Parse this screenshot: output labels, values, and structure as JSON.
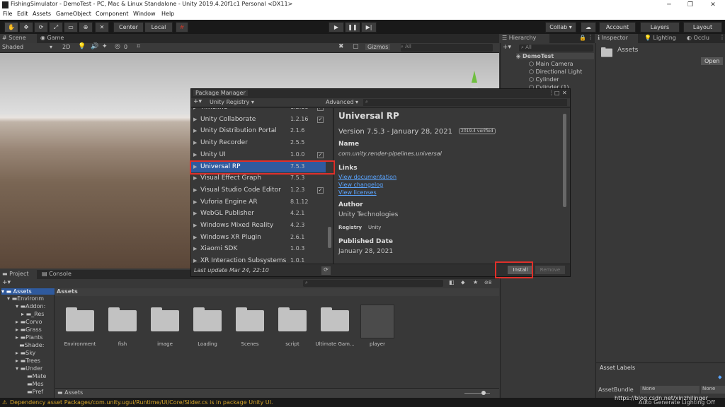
{
  "window": {
    "title": "FishingSimulator - DemoTest - PC, Mac & Linux Standalone - Unity 2019.4.20f1c1 Personal <DX11>",
    "controls": [
      "─",
      "❐",
      "✕"
    ]
  },
  "menu": [
    "File",
    "Edit",
    "Assets",
    "GameObject",
    "Component",
    "Window",
    "Help"
  ],
  "toolbar": {
    "center": "Center",
    "local": "Local",
    "collab": "Collab ▾",
    "account": "Account",
    "layers": "Layers",
    "layout": "Layout"
  },
  "scene": {
    "tabs": [
      "Scene",
      "Game"
    ],
    "shading": "Shaded",
    "mode_2d": "2D",
    "fx_count": "0",
    "gizmos": "Gizmos",
    "search_placeholder": "All"
  },
  "hierarchy": {
    "title": "Hierarchy",
    "search_placeholder": "All",
    "scene_name": "DemoTest",
    "items": [
      "Main Camera",
      "Directional Light",
      "Cylinder",
      "Cylinder (1)"
    ]
  },
  "inspector": {
    "tabs": [
      "Inspector",
      "Lighting",
      "Occlu"
    ],
    "asset_title": "Assets",
    "open_button": "Open",
    "asset_labels": "Asset Labels",
    "asset_bundle_label": "AssetBundle",
    "asset_bundle_value": "None",
    "asset_bundle_variant": "None"
  },
  "package_manager": {
    "title": "Package Manager",
    "registry": "Unity Registry",
    "advanced": "Advanced",
    "packages": [
      {
        "name": "Timeline",
        "version": "1.2.18",
        "checked": true
      },
      {
        "name": "Unity Collaborate",
        "version": "1.2.16",
        "checked": true
      },
      {
        "name": "Unity Distribution Portal",
        "version": "2.1.6",
        "checked": false
      },
      {
        "name": "Unity Recorder",
        "version": "2.5.5",
        "checked": false
      },
      {
        "name": "Unity UI",
        "version": "1.0.0",
        "checked": true
      },
      {
        "name": "Universal RP",
        "version": "7.5.3",
        "checked": false
      },
      {
        "name": "Visual Effect Graph",
        "version": "7.5.3",
        "checked": false
      },
      {
        "name": "Visual Studio Code Editor",
        "version": "1.2.3",
        "checked": true
      },
      {
        "name": "Vuforia Engine AR",
        "version": "8.1.12",
        "checked": false
      },
      {
        "name": "WebGL Publisher",
        "version": "4.2.1",
        "checked": false
      },
      {
        "name": "Windows Mixed Reality",
        "version": "4.2.3",
        "checked": false
      },
      {
        "name": "Windows XR Plugin",
        "version": "2.6.1",
        "checked": false
      },
      {
        "name": "Xiaomi SDK",
        "version": "1.0.3",
        "checked": false
      },
      {
        "name": "XR Interaction Subsystems",
        "version": "1.0.1",
        "checked": false
      }
    ],
    "last_update": "Last update Mar 24, 22:10",
    "detail": {
      "name": "Universal RP",
      "version_line": "Version 7.5.3 - January 28, 2021",
      "verified_badge": "2019.4 verified",
      "name_label": "Name",
      "package_id": "com.unity.render-pipelines.universal",
      "links_label": "Links",
      "links": [
        "View documentation",
        "View changelog",
        "View licenses"
      ],
      "author_label": "Author",
      "author": "Unity Technologies",
      "registry_label": "Registry",
      "registry": "Unity",
      "published_label": "Published Date",
      "published": "January 28,  2021"
    },
    "install": "Install",
    "remove": "Remove"
  },
  "project": {
    "tabs": [
      "Project",
      "Console"
    ],
    "tree": [
      "Assets",
      "Environm",
      "Addon:",
      "_Res",
      "Corvo",
      "Grass",
      "Plants",
      "Shade:",
      "Sky",
      "Trees",
      "Under",
      "Mate",
      "Mes",
      "Pref"
    ],
    "header": "Assets",
    "count": "8",
    "items": [
      "Environment",
      "fish",
      "image",
      "Loading",
      "Scenes",
      "script",
      "Ultimate Gam...",
      "player"
    ],
    "breadcrumb": "Assets"
  },
  "status": {
    "message": "Dependency asset Packages/com.unity.ugui/Runtime/UI/Core/Slider.cs is in package Unity UI.",
    "right": "Auto Generate Lighting Off",
    "watermark": "https://blog.csdn.net/xinzhilinger"
  },
  "colors": {
    "selection": "#2f5a9e",
    "highlight_box": "#e0302a",
    "link": "#5aa5ff",
    "status_warning": "#d6a62c"
  }
}
